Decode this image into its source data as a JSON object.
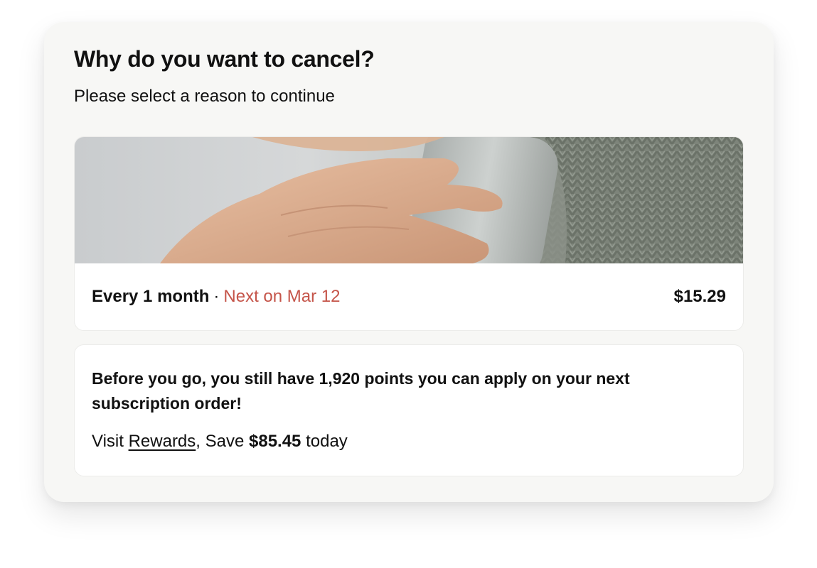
{
  "dialog": {
    "title": "Why do you want to cancel?",
    "subtitle": "Please select a reason to continue"
  },
  "subscription": {
    "frequency": "Every 1 month",
    "separator": "·",
    "next_date": "Next on Mar 12",
    "price": "$15.29",
    "image": "hands-holding-bottle-photo"
  },
  "points": {
    "message": "Before you go, you still have 1,920 points you can apply on your next subscription order!",
    "visit_prefix": "Visit",
    "rewards_link": "Rewards",
    "save_prefix": ", Save",
    "save_amount": "$85.45",
    "save_suffix": "today"
  },
  "colors": {
    "panel_bg": "#f7f7f5",
    "card_bg": "#ffffff",
    "next_date": "#c5554a",
    "text": "#111111"
  }
}
